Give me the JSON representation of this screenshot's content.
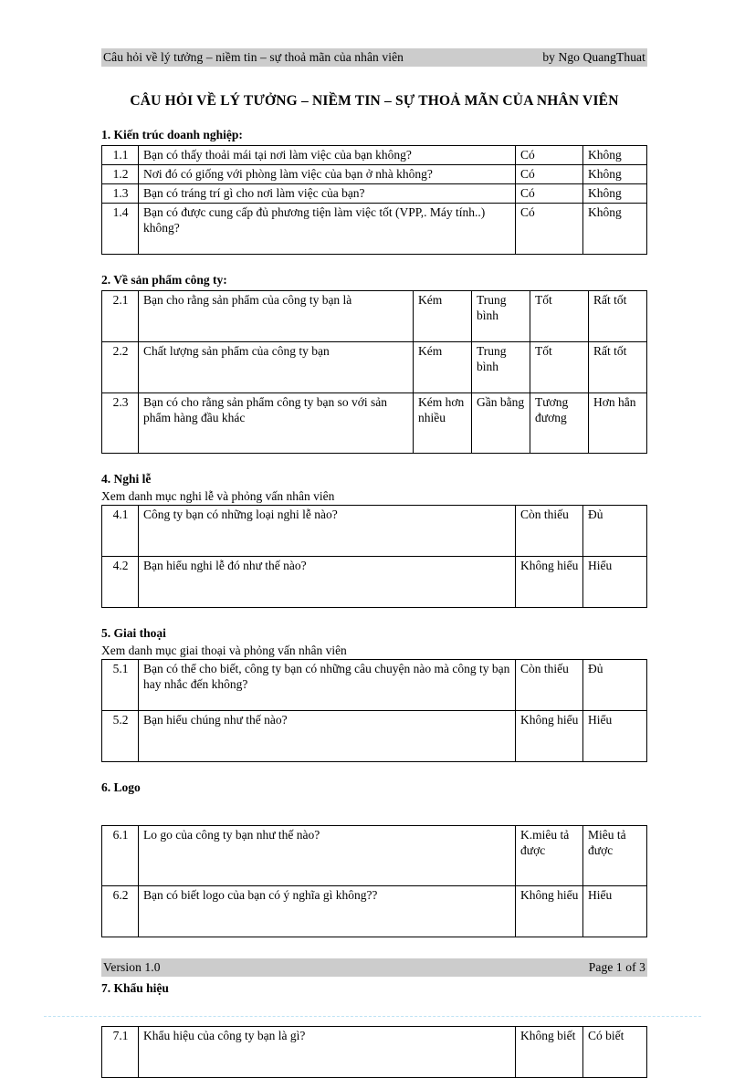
{
  "header": {
    "left": "Câu hỏi về lý tưởng – niềm tin – sự thoả mãn của nhân viên",
    "right": "by Ngo QuangThuat"
  },
  "title": "CÂU HỎI VỀ LÝ TƯỞNG – NIỀM TIN – SỰ THOẢ MÃN CỦA NHÂN VIÊN",
  "footer": {
    "left": "Version 1.0",
    "right": "Page 1 of 3"
  },
  "sections": [
    {
      "heading": "1. Kiến trúc doanh nghiệp:",
      "note": "",
      "rows": [
        {
          "num": "1.1",
          "question": "Bạn có thấy thoải mái tại nơi làm việc của bạn không?",
          "options": [
            "Có",
            "Không"
          ]
        },
        {
          "num": "1.2",
          "question": "Nơi đó có giống với phòng làm việc của bạn ở nhà không?",
          "options": [
            "Có",
            "Không"
          ]
        },
        {
          "num": "1.3",
          "question": "Bạn có tráng trí gì cho nơi làm việc của bạn?",
          "options": [
            "Có",
            "Không"
          ]
        },
        {
          "num": "1.4",
          "question": "Bạn có được cung cấp đủ phương tiện làm việc tốt (VPP,. Máy tính..) không?",
          "options": [
            "Có",
            "Không"
          ]
        }
      ]
    },
    {
      "heading": "2. Về sản phẩm công ty:",
      "note": "",
      "rows": [
        {
          "num": "2.1",
          "question": "Bạn cho rằng sản phẩm của công ty bạn là",
          "options": [
            "Kém",
            "Trung bình",
            "Tốt",
            "Rất tốt"
          ]
        },
        {
          "num": "2.2",
          "question": "Chất lượng sản phẩm của công ty bạn",
          "options": [
            "Kém",
            "Trung bình",
            "Tốt",
            "Rất tốt"
          ]
        },
        {
          "num": "2.3",
          "question": "Bạn có cho rằng sản phẩm công ty bạn so với sản phẩm hàng đầu khác",
          "options": [
            "Kém hơn nhiều",
            "Gần bằng",
            "Tương đương",
            "Hơn hẳn"
          ]
        }
      ]
    },
    {
      "heading": "4. Nghi lễ",
      "note": "Xem danh mục nghi lễ và phỏng vấn nhân viên",
      "rows": [
        {
          "num": "4.1",
          "question": "Công ty bạn có những loại nghi lễ nào?",
          "options": [
            "Còn thiếu",
            "Đủ"
          ]
        },
        {
          "num": "4.2",
          "question": "Bạn hiểu nghi lễ đó như thế nào?",
          "options": [
            "Không hiểu",
            "Hiểu"
          ]
        }
      ]
    },
    {
      "heading": "5. Giai thoại",
      "note": "Xem danh mục giai thoại và phỏng vấn nhân viên",
      "rows": [
        {
          "num": "5.1",
          "question": "Bạn có thể cho biết, công ty bạn có những câu chuyện nào mà công ty bạn hay nhắc đến không?",
          "options": [
            "Còn thiếu",
            "Đủ"
          ]
        },
        {
          "num": "5.2",
          "question": "Bạn hiểu chúng như thế nào?",
          "options": [
            "Không hiểu",
            "Hiểu"
          ]
        }
      ]
    },
    {
      "heading": "6. Logo",
      "note": "",
      "rows": [
        {
          "num": "6.1",
          "question": "Lo go của công ty bạn như thế nào?",
          "options": [
            "K.miêu tả được",
            "Miêu tả được"
          ]
        },
        {
          "num": "6.2",
          "question": "Bạn có biết logo của bạn có ý nghĩa gì không??",
          "options": [
            "Không hiểu",
            "Hiểu"
          ]
        }
      ]
    },
    {
      "heading": "7. Khẩu hiệu",
      "note": "",
      "rows": [
        {
          "num": "7.1",
          "question": "Khẩu hiệu của công ty bạn là gì?",
          "options": [
            "Không biết",
            "Có biết"
          ]
        }
      ]
    }
  ]
}
